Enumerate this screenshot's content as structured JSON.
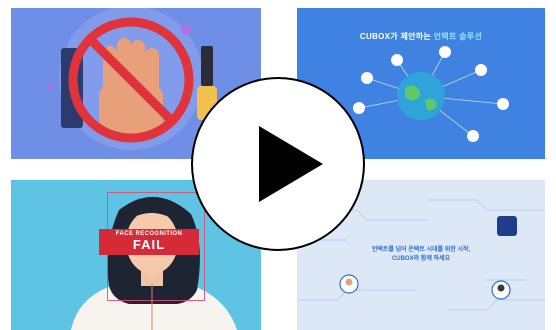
{
  "tiles": [
    {
      "id": "t1",
      "subject": "hand-stop-prohibited"
    },
    {
      "id": "t2",
      "title_brand": "CUBOX",
      "title_rest": "가 제안하는",
      "title_accent": "언택트 솔루션"
    },
    {
      "id": "t3",
      "label_top": "FACE RECOGNITION",
      "label_main": "FAIL"
    },
    {
      "id": "t4",
      "line1": "언택트를 넘어 온택트 시대를 위한 시작,",
      "line2": "CUBOX와 함께 하세요"
    }
  ],
  "colors": {
    "tile1": "#6f8fe6",
    "tile2": "#3f82e2",
    "tile3": "#5fc3e4",
    "tile4": "#dde8f6",
    "fail": "#d52a38"
  },
  "icons": [
    "play-icon",
    "globe-icon",
    "hand-icon",
    "prohibited-icon"
  ]
}
